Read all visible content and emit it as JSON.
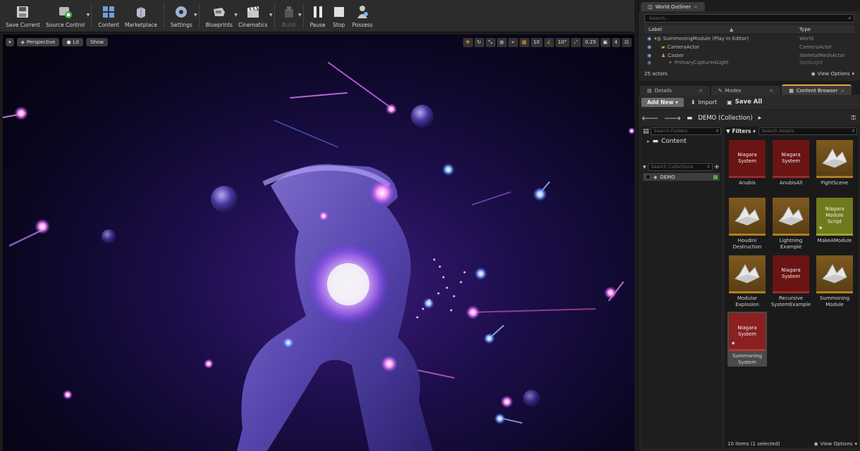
{
  "toolbar": {
    "buttons": [
      {
        "label": "Save Current",
        "icon": "save-icon"
      },
      {
        "label": "Source Control",
        "icon": "source-control-icon"
      },
      {
        "label": "Content",
        "icon": "content-icon"
      },
      {
        "label": "Marketplace",
        "icon": "marketplace-icon"
      },
      {
        "label": "Settings",
        "icon": "settings-icon"
      },
      {
        "label": "Blueprints",
        "icon": "blueprints-icon"
      },
      {
        "label": "Cinematics",
        "icon": "cinematics-icon"
      },
      {
        "label": "Build",
        "icon": "build-icon"
      },
      {
        "label": "Pause",
        "icon": "pause-icon"
      },
      {
        "label": "Stop",
        "icon": "stop-icon"
      },
      {
        "label": "Possess",
        "icon": "possess-icon"
      }
    ]
  },
  "viewport": {
    "perspective": "Perspective",
    "lit": "Lit",
    "show": "Show",
    "grid_snap": "10",
    "rotation_snap": "10°",
    "scale_snap": "0.25",
    "camera_speed": "4"
  },
  "outliner": {
    "tab": "World Outliner",
    "search_placeholder": "Search...",
    "col_label": "Label",
    "col_type": "Type",
    "rows": [
      {
        "label": "SummoningModule (Play In Editor)",
        "type": "World"
      },
      {
        "label": "CameraActor",
        "type": "CameraActor"
      },
      {
        "label": "Caster",
        "type": "SkeletalMeshActor"
      },
      {
        "label": "PrimaryCapturedLight",
        "type": "SpotLight"
      }
    ],
    "count": "25 actors",
    "view_options": "View Options"
  },
  "tabs": {
    "details": "Details",
    "modes": "Modes",
    "content_browser": "Content Browser"
  },
  "content_browser": {
    "add_new": "Add New",
    "import": "Import",
    "save_all": "Save All",
    "path": "DEMO (Collection)",
    "search_folders": "Search Folders",
    "content_folder": "Content",
    "search_collections": "Search Collections",
    "collection": "DEMO",
    "filters": "Filters",
    "search_assets": "Search Assets",
    "assets": [
      {
        "name": "Anubis",
        "kind": "niagara",
        "thumb_text": "Niagara System"
      },
      {
        "name": "AnubisAll",
        "kind": "niagara",
        "thumb_text": "Niagara System"
      },
      {
        "name": "FightScene",
        "kind": "mesh",
        "thumb_text": ""
      },
      {
        "name": "Houdini Destruction",
        "kind": "mesh",
        "thumb_text": ""
      },
      {
        "name": "Lightning Example",
        "kind": "mesh",
        "thumb_text": ""
      },
      {
        "name": "MakeAModule",
        "kind": "module",
        "thumb_text": "Niagara Module Script"
      },
      {
        "name": "Modular Explosion",
        "kind": "mesh",
        "thumb_text": ""
      },
      {
        "name": "Recursive SystemExample",
        "kind": "niagara",
        "thumb_text": "Niagara System"
      },
      {
        "name": "Summoning Module",
        "kind": "mesh",
        "thumb_text": ""
      },
      {
        "name": "Summoning System",
        "kind": "niagara",
        "thumb_text": "Niagara System"
      }
    ],
    "status": "10 items (1 selected)",
    "view_options": "View Options"
  }
}
